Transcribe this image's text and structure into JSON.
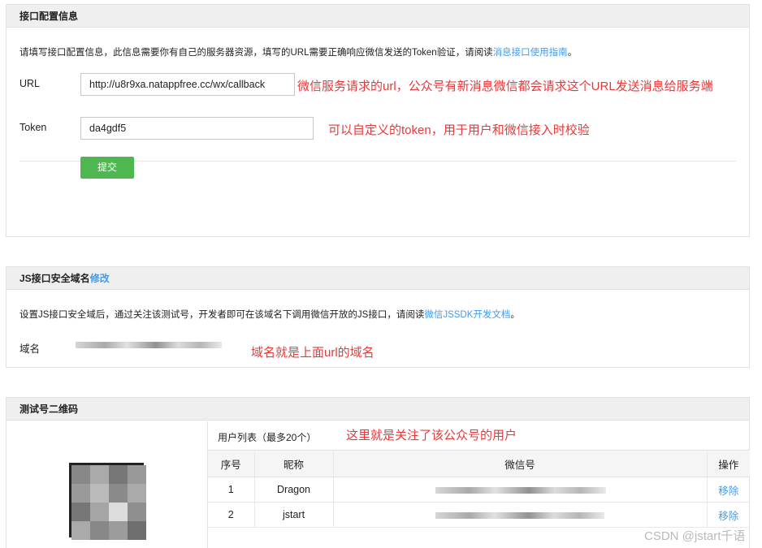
{
  "interface": {
    "heading": "接口配置信息",
    "description_text": "请填写接口配置信息，此信息需要你有自己的服务器资源，填写的URL需要正确响应微信发送的Token验证，请阅读",
    "description_link": "消息接口使用指南",
    "description_end": "。",
    "url_label": "URL",
    "url_value": "http://u8r9xa.natappfree.cc/wx/callback",
    "url_annotation": "微信服务请求的url，公众号有新消息微信都会请求这个URL发送消息给服务端",
    "token_label": "Token",
    "token_value": "da4gdf5",
    "token_annotation": "可以自定义的token，用于用户和微信接入时校验",
    "submit_label": "提交"
  },
  "js_domain": {
    "heading": "JS接口安全域名",
    "heading_link": "修改",
    "description_text": "设置JS接口安全域后，通过关注该测试号，开发者即可在该域名下调用微信开放的JS接口，请阅读",
    "description_link": "微信JSSDK开发文档",
    "description_end": "。",
    "domain_label": "域名",
    "domain_annotation": "域名就是上面url的域名"
  },
  "qrcode": {
    "heading": "测试号二维码",
    "user_list_title": "用户列表（最多20个）",
    "user_list_annotation": "这里就是关注了该公众号的用户",
    "columns": [
      "序号",
      "昵称",
      "微信号",
      "操作"
    ],
    "rows": [
      {
        "index": "1",
        "nickname": "Dragon",
        "action": "移除"
      },
      {
        "index": "2",
        "nickname": "jstart",
        "action": "移除"
      }
    ]
  },
  "watermark": "CSDN @jstart千语",
  "colors": {
    "link": "#459ae9",
    "annotation": "#e8393a",
    "submit": "#4fb74f"
  }
}
